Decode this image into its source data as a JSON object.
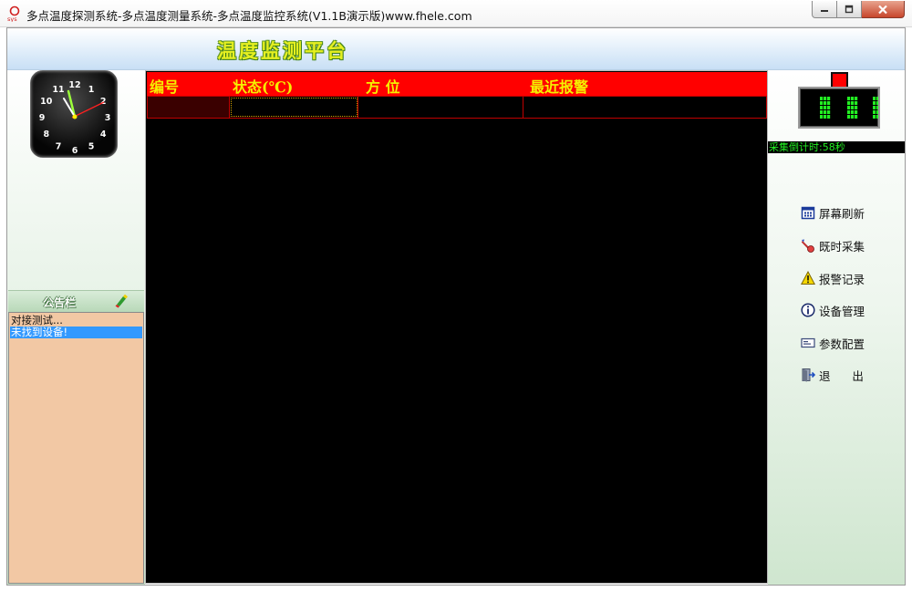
{
  "window": {
    "title": "多点温度探测系统-多点温度测量系统-多点温度监控系统(V1.1B演示版)www.fhele.com"
  },
  "header": {
    "title": "温度监测平台"
  },
  "clock": {
    "numbers": [
      "12",
      "1",
      "2",
      "3",
      "4",
      "5",
      "6",
      "7",
      "8",
      "9",
      "10",
      "11"
    ]
  },
  "notice": {
    "title": "公告栏",
    "items": [
      {
        "text": "对接测试...",
        "selected": false
      },
      {
        "text": "未找到设备!",
        "selected": true
      }
    ]
  },
  "grid": {
    "columns": [
      "编号",
      "状态(℃)",
      "方 位",
      "最近报警"
    ],
    "rows": [
      [
        "",
        "",
        "",
        ""
      ]
    ]
  },
  "status": {
    "countdown": "采集倒计时:58秒"
  },
  "menu": [
    {
      "label": "屏幕刷新",
      "icon": "calendar-icon"
    },
    {
      "label": "既时采集",
      "icon": "edit-tool-icon"
    },
    {
      "label": "报警记录",
      "icon": "warning-icon"
    },
    {
      "label": "设备管理",
      "icon": "info-icon"
    },
    {
      "label": "参数配置",
      "icon": "card-icon"
    },
    {
      "label": "退      出",
      "icon": "exit-door-icon"
    }
  ],
  "colors": {
    "grid_header": "#ff0000",
    "grid_header_text": "#f5f000",
    "led": "#22ee22",
    "notice_bg": "#f2c8a4",
    "selection": "#3399ff"
  }
}
